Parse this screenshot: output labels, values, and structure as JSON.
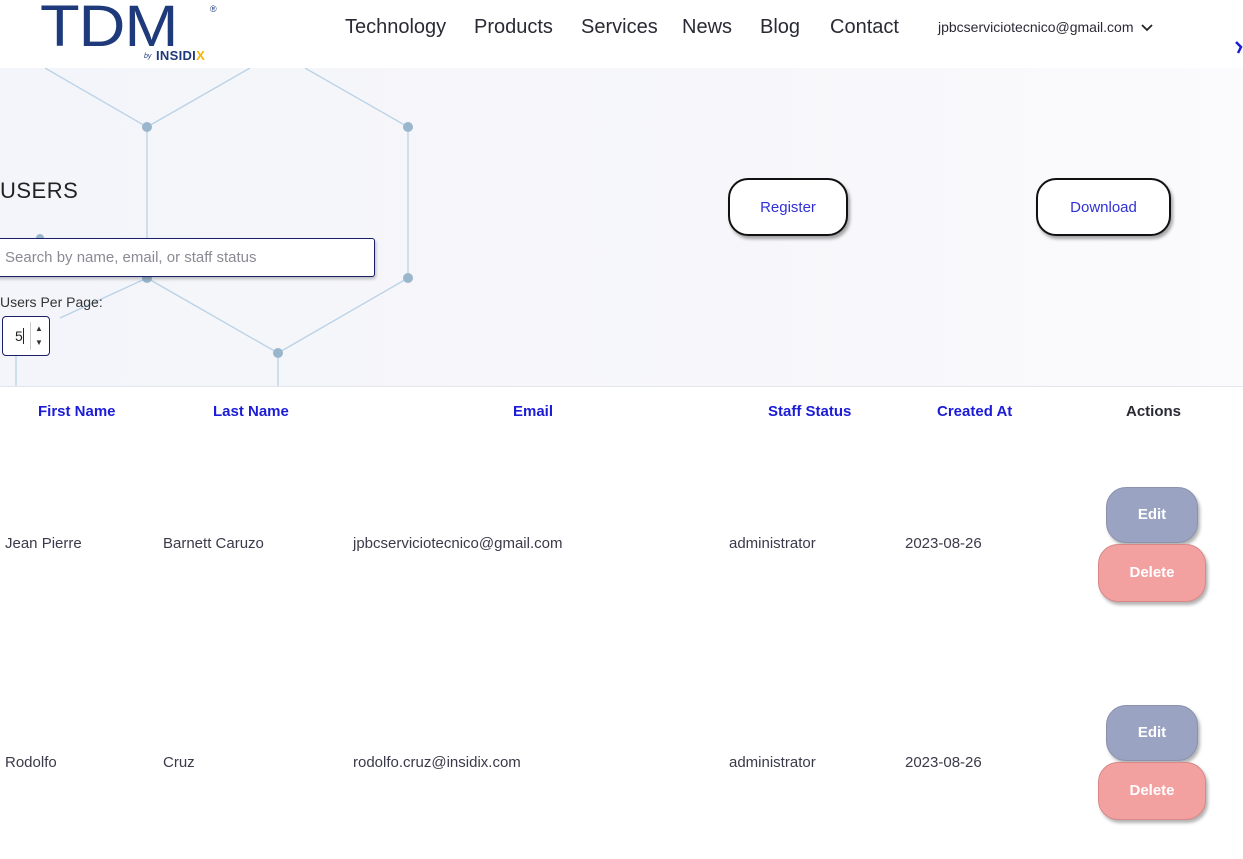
{
  "brand": {
    "logo_text": "TDM",
    "registered": "®",
    "by": "by",
    "brand_name": "INSIDIX",
    "accent": "#1e3a7a",
    "x_color": "#f2b705"
  },
  "nav": {
    "items": [
      {
        "label": "Technology"
      },
      {
        "label": "Products"
      },
      {
        "label": "Services"
      },
      {
        "label": "News"
      },
      {
        "label": "Blog"
      },
      {
        "label": "Contact"
      }
    ],
    "user_email": "jpbcserviciotecnico@gmail.com",
    "user_menu_icon": "chevron-down-icon"
  },
  "page": {
    "title": "USERS",
    "search_placeholder": "Search by name, email, or staff status",
    "search_value": "",
    "per_page_label": "Users Per Page:",
    "per_page_value": "5",
    "register_label": "Register",
    "download_label": "Download"
  },
  "table": {
    "headers": {
      "first_name": "First Name",
      "last_name": "Last Name",
      "email": "Email",
      "staff_status": "Staff Status",
      "created_at": "Created At",
      "actions": "Actions"
    },
    "rows": [
      {
        "first_name": "Jean Pierre",
        "last_name": "Barnett Caruzo",
        "email": "jpbcserviciotecnico@gmail.com",
        "staff_status": "administrator",
        "created_at": "2023-08-26",
        "edit": "Edit",
        "delete": "Delete"
      },
      {
        "first_name": "Rodolfo",
        "last_name": "Cruz",
        "email": "rodolfo.cruz@insidix.com",
        "staff_status": "administrator",
        "created_at": "2023-08-26",
        "edit": "Edit",
        "delete": "Delete"
      }
    ]
  },
  "colors": {
    "header_link": "#1c1cd6",
    "edit_button": "#9aa3c2",
    "delete_button": "#f2a0a0",
    "input_border": "#1a1f6a"
  }
}
